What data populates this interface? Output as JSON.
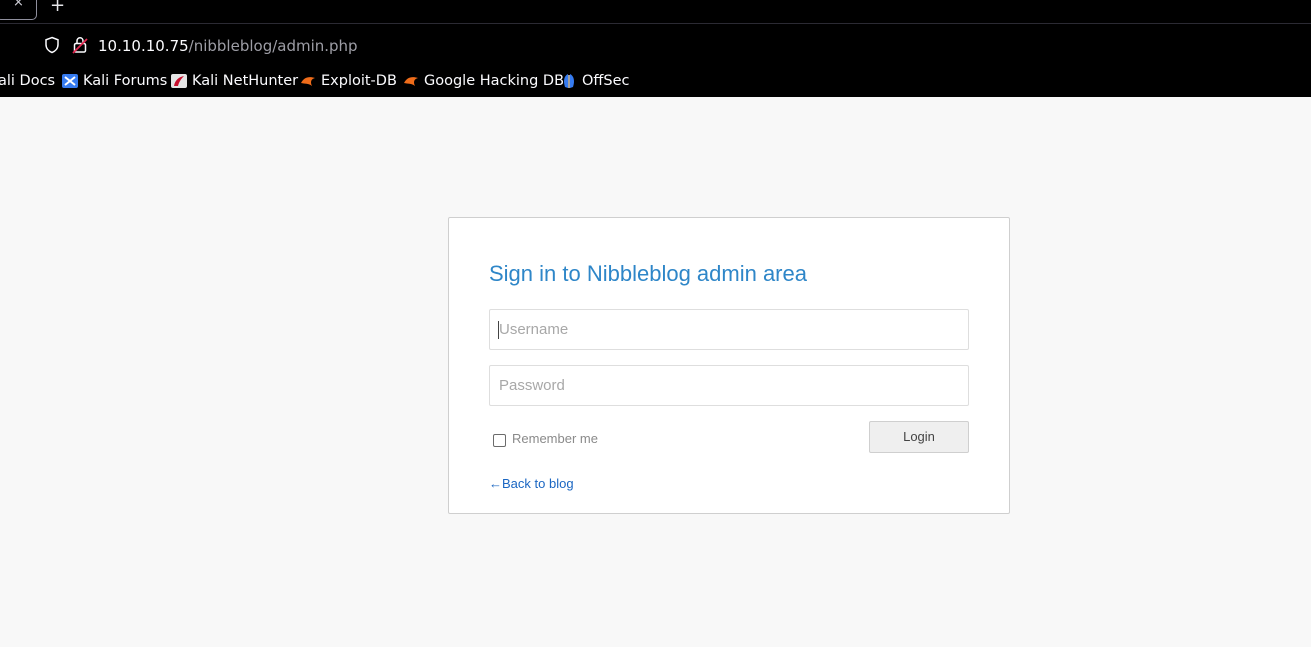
{
  "browser": {
    "tab_close_glyph": "×",
    "new_tab_glyph": "+",
    "url": {
      "host": "10.10.10.75",
      "path": "/nibbleblog/admin.php"
    },
    "bookmarks": [
      {
        "label": "ali Docs",
        "icon": "kali-docs-icon"
      },
      {
        "label": "Kali Forums",
        "icon": "kali-forums-icon"
      },
      {
        "label": "Kali NetHunter",
        "icon": "kali-nethunter-icon"
      },
      {
        "label": "Exploit-DB",
        "icon": "exploit-db-icon"
      },
      {
        "label": "Google Hacking DB",
        "icon": "ghdb-icon"
      },
      {
        "label": "OffSec",
        "icon": "offsec-icon"
      }
    ]
  },
  "login": {
    "title": "Sign in to Nibbleblog admin area",
    "username": {
      "value": "",
      "placeholder": "Username"
    },
    "password": {
      "value": "",
      "placeholder": "Password"
    },
    "remember_label": "Remember me",
    "remember_checked": false,
    "login_label": "Login",
    "back_link": "←Back to blog"
  },
  "colors": {
    "title": "#2e86c8",
    "link": "#1a66c2",
    "page_bg": "#f8f8f8",
    "chrome_bg": "#000000"
  }
}
